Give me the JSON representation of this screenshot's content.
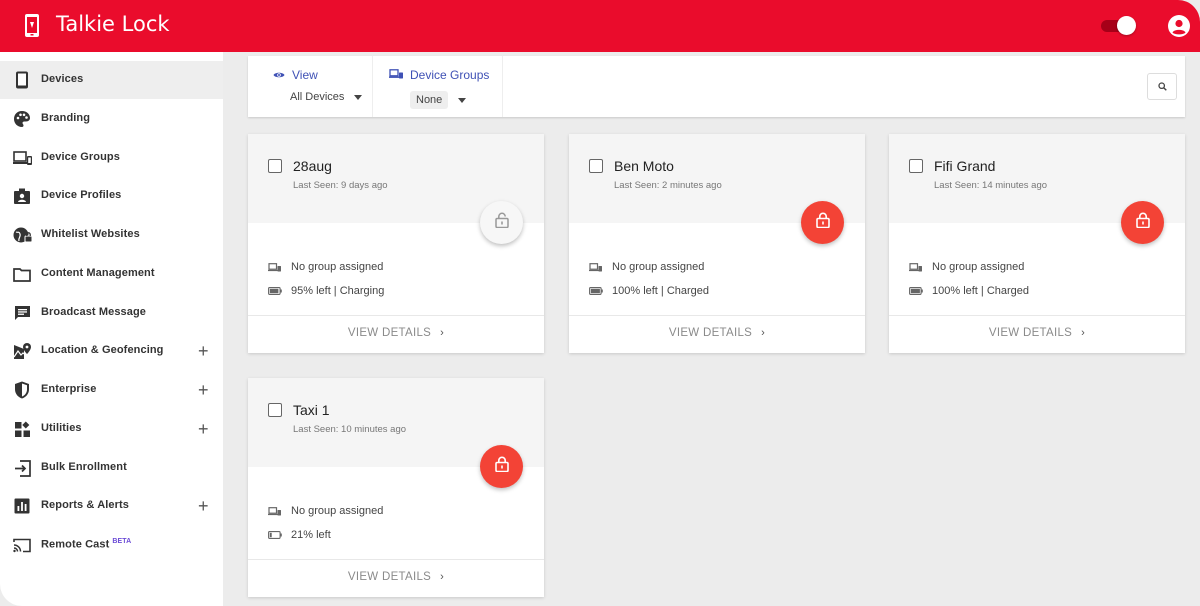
{
  "app": {
    "title": "Talkie Lock",
    "brand_color": "#ea0c2c"
  },
  "sidebar": {
    "items": [
      {
        "label": "Devices",
        "icon": "phone-icon",
        "active": true,
        "expandable": false
      },
      {
        "label": "Branding",
        "icon": "palette-icon",
        "expandable": false
      },
      {
        "label": "Device Groups",
        "icon": "devices-icon",
        "expandable": false
      },
      {
        "label": "Device Profiles",
        "icon": "profile-card-icon",
        "expandable": false
      },
      {
        "label": "Whitelist Websites",
        "icon": "globe-lock-icon",
        "expandable": false
      },
      {
        "label": "Content Management",
        "icon": "folder-icon",
        "expandable": false
      },
      {
        "label": "Broadcast Message",
        "icon": "message-icon",
        "expandable": false
      },
      {
        "label": "Location & Geofencing",
        "icon": "map-icon",
        "expandable": true
      },
      {
        "label": "Enterprise",
        "icon": "shield-icon",
        "expandable": true
      },
      {
        "label": "Utilities",
        "icon": "widgets-icon",
        "expandable": true
      },
      {
        "label": "Bulk Enrollment",
        "icon": "enroll-icon",
        "expandable": false
      },
      {
        "label": "Reports & Alerts",
        "icon": "chart-icon",
        "expandable": true
      },
      {
        "label": "Remote Cast",
        "badge": "BETA",
        "icon": "cast-icon",
        "expandable": false
      }
    ],
    "plus": "+"
  },
  "toolbar": {
    "view_label": "View",
    "view_value": "All Devices",
    "groups_label": "Device Groups",
    "groups_value": "None"
  },
  "devices": [
    {
      "name": "28aug",
      "last_seen": "Last Seen: 9 days ago",
      "group": "No group assigned",
      "battery": "95% left | Charging",
      "locked": false
    },
    {
      "name": "Ben Moto",
      "last_seen": "Last Seen: 2 minutes ago",
      "group": "No group assigned",
      "battery": "100% left | Charged",
      "locked": true
    },
    {
      "name": "Fifi Grand",
      "last_seen": "Last Seen: 14 minutes ago",
      "group": "No group assigned",
      "battery": "100% left | Charged",
      "locked": true
    },
    {
      "name": "Taxi 1",
      "last_seen": "Last Seen: 10 minutes ago",
      "group": "No group assigned",
      "battery": "21% left",
      "locked": true
    }
  ],
  "card_action": "VIEW DETAILS"
}
